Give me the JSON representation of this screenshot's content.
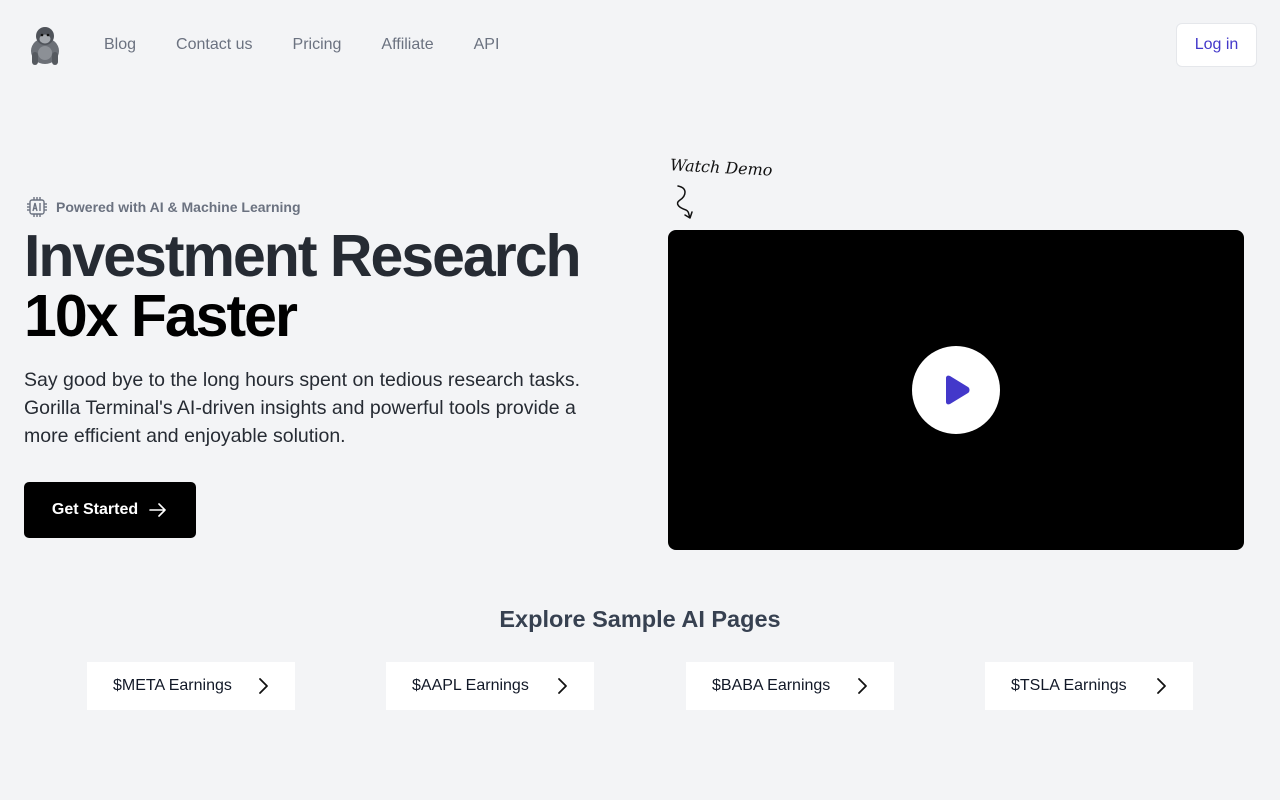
{
  "nav": {
    "logo_icon": "gorilla-icon",
    "links": [
      {
        "label": "Blog"
      },
      {
        "label": "Contact us"
      },
      {
        "label": "Pricing"
      },
      {
        "label": "Affiliate"
      },
      {
        "label": "API"
      }
    ],
    "login_label": "Log in"
  },
  "hero": {
    "badge_icon": "ai-chip-icon",
    "badge_text": "Powered with AI & Machine Learning",
    "headline_line1": "Investment Research",
    "headline_line2": "10x Faster",
    "subtitle": "Say good bye to the long hours spent on tedious research tasks. Gorilla Terminal's AI-driven insights and powerful tools provide a more efficient and enjoyable solution.",
    "cta_label": "Get Started",
    "cta_icon": "arrow-right-icon"
  },
  "demo": {
    "label": "Watch Demo",
    "play_icon": "play-icon"
  },
  "samples": {
    "title": "Explore Sample AI Pages",
    "items": [
      {
        "label": "$META Earnings"
      },
      {
        "label": "$AAPL Earnings"
      },
      {
        "label": "$BABA Earnings"
      },
      {
        "label": "$TSLA Earnings"
      }
    ]
  },
  "colors": {
    "background": "#f3f4f6",
    "accent": "#4338ca",
    "cta": "#000000"
  }
}
